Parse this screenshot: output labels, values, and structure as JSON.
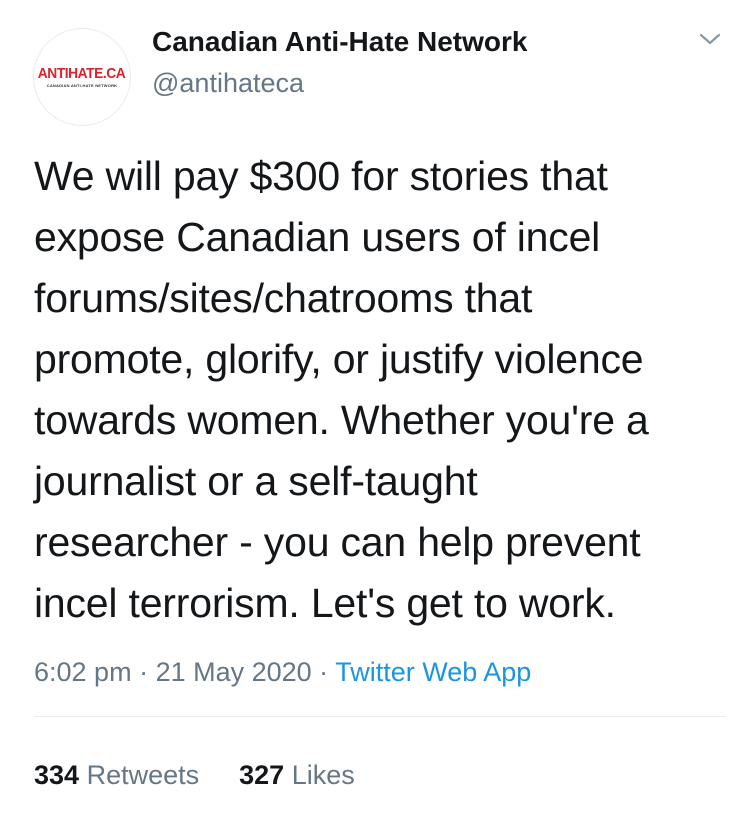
{
  "author": {
    "name": "Canadian Anti-Hate Network",
    "handle": "@antihateca",
    "avatar_logo_text": "ANTIHATE.CA",
    "avatar_logo_subtext": "CANADIAN ANTI-HATE NETWORK",
    "avatar_logo_color": "#e0202a"
  },
  "tweet": {
    "lines": [
      "We will pay $300 for stories that",
      "expose Canadian users of incel",
      "forums/sites/chatrooms that",
      "promote, glorify, or justify violence",
      "towards women. Whether you're a",
      "journalist or a self-taught",
      "researcher - you can help prevent",
      "incel terrorism. Let's get to work."
    ]
  },
  "meta": {
    "time": "6:02 pm",
    "separator": " · ",
    "date": "21 May 2020",
    "app": "Twitter Web App",
    "link_color": "#1b95e0"
  },
  "stats": {
    "retweets_count": "334",
    "retweets_label": "Retweets",
    "likes_count": "327",
    "likes_label": "Likes"
  },
  "icons": {
    "menu": "chevron-down-icon"
  }
}
